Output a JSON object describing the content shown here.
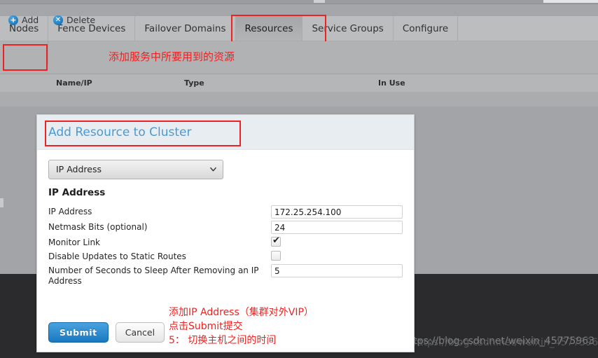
{
  "nav": {
    "tabs": [
      {
        "label": "Nodes",
        "active": false
      },
      {
        "label": "Fence Devices",
        "active": false
      },
      {
        "label": "Failover Domains",
        "active": false
      },
      {
        "label": "Resources",
        "active": true
      },
      {
        "label": "Service Groups",
        "active": false
      },
      {
        "label": "Configure",
        "active": false
      }
    ]
  },
  "toolbar": {
    "add_label": "Add",
    "add_icon": "plus-circle-icon",
    "delete_label": "Delete",
    "delete_icon": "close-circle-icon",
    "note": "添加服务中所要用到的资源"
  },
  "table": {
    "columns": [
      "Name/IP",
      "Type",
      "In Use"
    ]
  },
  "dialog": {
    "title": "Add Resource to Cluster",
    "resource_type": {
      "selected": "IP Address",
      "caret_icon": "chevron-down-icon",
      "options": [
        "IP Address"
      ]
    },
    "section_title": "IP Address",
    "fields": [
      {
        "label": "IP Address",
        "type": "text",
        "value": "172.25.254.100"
      },
      {
        "label": "Netmask Bits (optional)",
        "type": "text",
        "value": "24"
      },
      {
        "label": "Monitor Link",
        "type": "checkbox",
        "checked": true
      },
      {
        "label": "Disable Updates to Static Routes",
        "type": "checkbox",
        "checked": false
      },
      {
        "label": "Number of Seconds to Sleep After Removing an IP Address",
        "type": "text",
        "value": "5"
      }
    ],
    "submit_label": "Submit",
    "cancel_label": "Cancel"
  },
  "annotations": {
    "line1": "添加IP Address（集群对外VIP）",
    "line2": "点击Submit提交",
    "line3": "5： 切换主机之间的时间"
  },
  "watermark": {
    "text": "https://blog.csdn.net/weixin_45775963",
    "ghost": "https://blog.csdn.net/weixin_45775963"
  },
  "colors": {
    "accent_blue": "#1878c0",
    "title_blue": "#4b9ad4",
    "annotation_red": "#ee2222",
    "highlight_red": "#ee2222",
    "page_gray": "#a4a6aa",
    "dark_region": "#2b2b2d"
  }
}
